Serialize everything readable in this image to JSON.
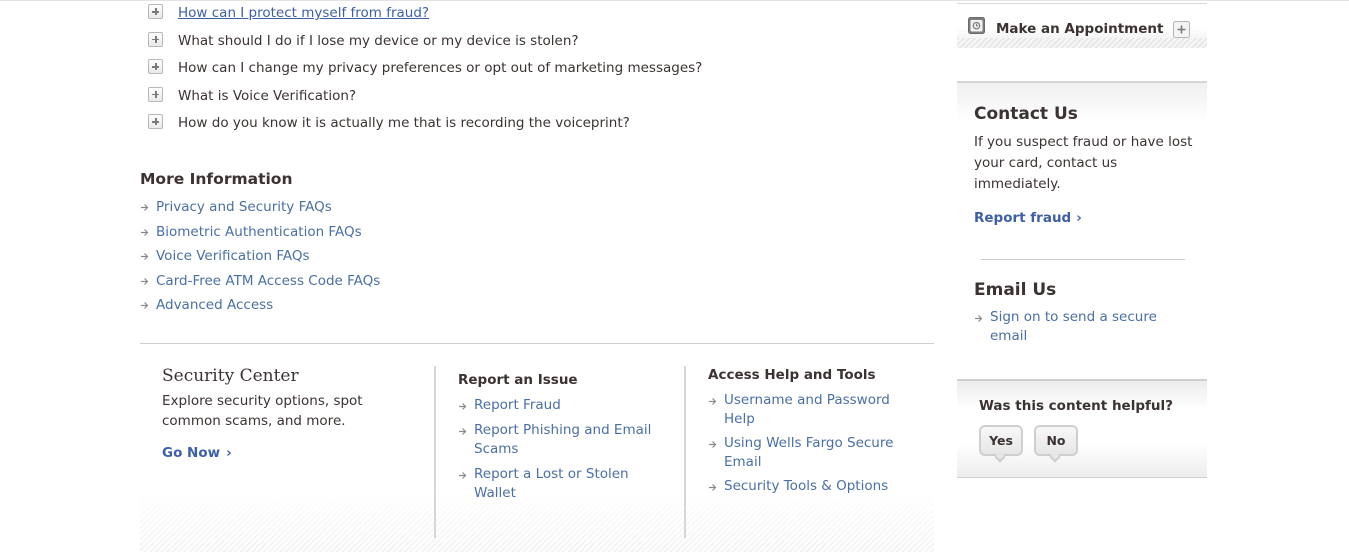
{
  "faq": {
    "items": [
      {
        "label": "How can I protect myself from fraud?",
        "active": true
      },
      {
        "label": "What should I do if I lose my device or my device is stolen?"
      },
      {
        "label": "How can I change my privacy preferences or opt out of marketing messages?"
      },
      {
        "label": "What is Voice Verification?"
      },
      {
        "label": "How do you know it is actually me that is recording the voiceprint?"
      }
    ]
  },
  "more_info": {
    "title": "More Information",
    "links": [
      "Privacy and Security FAQs",
      "Biometric Authentication FAQs",
      "Voice Verification FAQs",
      "Card-Free ATM Access Code FAQs",
      "Advanced Access"
    ]
  },
  "footer": {
    "security_center": {
      "title": "Security Center",
      "description": "Explore security options, spot common scams, and more.",
      "cta": "Go Now"
    },
    "report_issue": {
      "title": "Report an Issue",
      "links": [
        "Report Fraud",
        "Report Phishing and Email Scams",
        "Report a Lost or Stolen Wallet"
      ]
    },
    "access_help": {
      "title": "Access Help and Tools",
      "links": [
        "Username and Password Help",
        "Using Wells Fargo Secure Email",
        "Security Tools & Options"
      ]
    }
  },
  "sidebar": {
    "appointment": {
      "label": "Make an Appointment"
    },
    "contact": {
      "title": "Contact Us",
      "description": "If you suspect fraud or have lost your card, contact us immediately.",
      "link": "Report fraud"
    },
    "email": {
      "title": "Email Us",
      "link": "Sign on to send a secure email"
    },
    "feedback": {
      "question": "Was this content helpful?",
      "yes": "Yes",
      "no": "No"
    }
  },
  "colors": {
    "link": "#4a6fa5",
    "text": "#3b3331",
    "divider": "#cfcfcf"
  },
  "icons": {
    "expand": "plus-icon",
    "bullet": "arrow-right-icon",
    "appointment": "calendar-icon",
    "chevron": "chevron-right-icon"
  }
}
